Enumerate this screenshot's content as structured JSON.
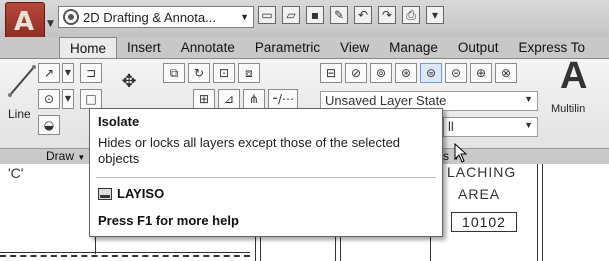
{
  "quick_access": {
    "workspace": "2D Drafting & Annota...",
    "icons": [
      "new-icon",
      "open-icon",
      "save-icon",
      "save-as-icon",
      "undo-icon",
      "redo-icon",
      "plot-icon",
      "customize-icon"
    ]
  },
  "tabs": [
    {
      "label": "Home",
      "active": true
    },
    {
      "label": "Insert"
    },
    {
      "label": "Annotate"
    },
    {
      "label": "Parametric"
    },
    {
      "label": "View"
    },
    {
      "label": "Manage"
    },
    {
      "label": "Output"
    },
    {
      "label": "Express To"
    }
  ],
  "ribbon": {
    "line_label": "Line",
    "draw_panel": "Draw",
    "layers_panel": "s",
    "layer_state": "Unsaved Layer State",
    "layer_combo2": "ll",
    "text_big": "A",
    "multiline_label": "Multilin"
  },
  "tooltip": {
    "title": "Isolate",
    "description": "Hides or locks all layers except those of the selected objects",
    "command": "LAYISO",
    "help": "Press F1 for more help"
  },
  "drawing": {
    "label_c": "'C'",
    "room_name_1": "LACHING",
    "room_name_2": "AREA",
    "room_number": "10102"
  }
}
